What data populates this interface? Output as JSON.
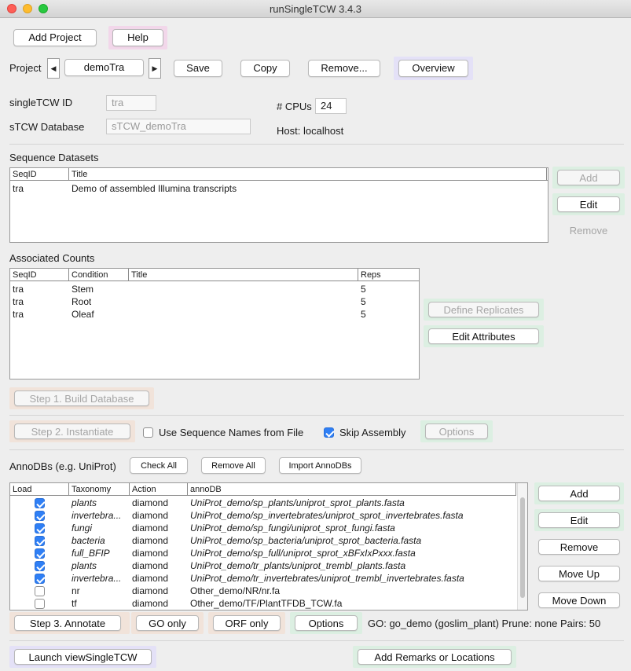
{
  "window": {
    "title": "runSingleTCW 3.4.3"
  },
  "colors": {
    "highlight_pink": "#f2d7ea",
    "highlight_purple": "#e4e1f7",
    "highlight_green": "#dcefe2",
    "highlight_tan": "#f1e3da",
    "check_blue": "#2f7ff5"
  },
  "toolbar": {
    "add_project": "Add Project",
    "help": "Help"
  },
  "project": {
    "label": "Project",
    "selected": "demoTra",
    "save": "Save",
    "copy": "Copy",
    "remove": "Remove...",
    "overview": "Overview",
    "prev_icon": "left-arrow-icon",
    "next_icon": "right-arrow-icon"
  },
  "ids": {
    "singletcw_label": "singleTCW ID",
    "singletcw_value": "tra",
    "db_label": "sTCW Database",
    "db_value": "sTCW_demoTra",
    "cpus_label": "# CPUs",
    "cpus_value": "24",
    "host_label": "Host:",
    "host_value": "localhost"
  },
  "sequence_datasets": {
    "title": "Sequence Datasets",
    "columns": [
      "SeqID",
      "Title"
    ],
    "rows": [
      [
        "tra",
        "Demo of assembled Illumina transcripts"
      ]
    ],
    "add": "Add",
    "edit": "Edit",
    "remove": "Remove"
  },
  "associated_counts": {
    "title": "Associated Counts",
    "columns": [
      "SeqID",
      "Condition",
      "Title",
      "Reps"
    ],
    "rows": [
      [
        "tra",
        "Stem",
        "",
        "5"
      ],
      [
        "tra",
        "Root",
        "",
        "5"
      ],
      [
        "tra",
        "Oleaf",
        "",
        "5"
      ]
    ],
    "define_replicates": "Define Replicates",
    "edit_attributes": "Edit Attributes"
  },
  "steps": {
    "step1": "Step 1. Build Database",
    "step2": "Step 2. Instantiate",
    "use_seq_names": "Use Sequence Names from File",
    "use_seq_names_checked": false,
    "skip_assembly": "Skip Assembly",
    "skip_assembly_checked": true,
    "options": "Options"
  },
  "annodbs": {
    "title": "AnnoDBs (e.g. UniProt)",
    "check_all": "Check All",
    "remove_all": "Remove All",
    "import": "Import AnnoDBs",
    "columns": [
      "Load",
      "Taxonomy",
      "Action",
      "annoDB"
    ],
    "rows": [
      {
        "load": true,
        "taxonomy": "plants",
        "action": "diamond",
        "annodb": "UniProt_demo/sp_plants/uniprot_sprot_plants.fasta",
        "italic": true
      },
      {
        "load": true,
        "taxonomy": "invertebra...",
        "action": "diamond",
        "annodb": "UniProt_demo/sp_invertebrates/uniprot_sprot_invertebrates.fasta",
        "italic": true
      },
      {
        "load": true,
        "taxonomy": "fungi",
        "action": "diamond",
        "annodb": "UniProt_demo/sp_fungi/uniprot_sprot_fungi.fasta",
        "italic": true
      },
      {
        "load": true,
        "taxonomy": "bacteria",
        "action": "diamond",
        "annodb": "UniProt_demo/sp_bacteria/uniprot_sprot_bacteria.fasta",
        "italic": true
      },
      {
        "load": true,
        "taxonomy": "full_BFIP",
        "action": "diamond",
        "annodb": "UniProt_demo/sp_full/uniprot_sprot_xBFxIxPxxx.fasta",
        "italic": true
      },
      {
        "load": true,
        "taxonomy": "plants",
        "action": "diamond",
        "annodb": "UniProt_demo/tr_plants/uniprot_trembl_plants.fasta",
        "italic": true
      },
      {
        "load": true,
        "taxonomy": "invertebra...",
        "action": "diamond",
        "annodb": "UniProt_demo/tr_invertebrates/uniprot_trembl_invertebrates.fasta",
        "italic": true
      },
      {
        "load": false,
        "taxonomy": "nr",
        "action": "diamond",
        "annodb": "Other_demo/NR/nr.fa",
        "italic": false
      },
      {
        "load": false,
        "taxonomy": "tf",
        "action": "diamond",
        "annodb": "Other_demo/TF/PlantTFDB_TCW.fa",
        "italic": false
      }
    ],
    "add": "Add",
    "edit": "Edit",
    "remove": "Remove",
    "move_up": "Move Up",
    "move_down": "Move Down"
  },
  "annotate": {
    "step3": "Step 3. Annotate",
    "go_only": "GO only",
    "orf_only": "ORF only",
    "options": "Options",
    "status": "GO: go_demo (goslim_plant)  Prune: none  Pairs: 50"
  },
  "footer": {
    "launch": "Launch viewSingleTCW",
    "remarks": "Add Remarks or Locations"
  }
}
